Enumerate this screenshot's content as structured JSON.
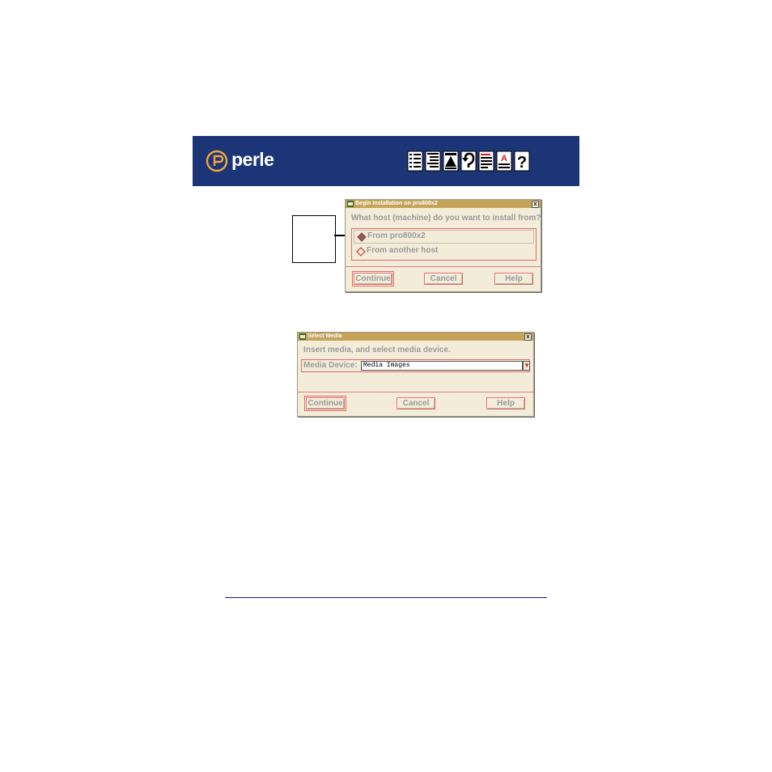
{
  "banner": {
    "brand": "perle",
    "toolbar_icons": [
      "contents-icon",
      "index-icon",
      "top-icon",
      "back-icon",
      "document-icon",
      "text-icon",
      "help-icon"
    ],
    "help_glyph": "?",
    "text_glyph": "A"
  },
  "dialog_install": {
    "title": "Begin Installation on pro800x2",
    "close_glyph": "x",
    "prompt": "What host (machine) do you want to install from?",
    "options": [
      {
        "label": "From pro800x2",
        "selected": true
      },
      {
        "label": "From another host",
        "selected": false
      }
    ],
    "continue_label": "Continue",
    "cancel_label": "Cancel",
    "help_label": "Help"
  },
  "dialog_media": {
    "title": "Select Media",
    "close_glyph": "x",
    "prompt": "Insert media, and select media device.",
    "field_label": "Media Device:",
    "field_value": "Media Images",
    "dropdown_glyph": "▼",
    "continue_label": "Continue",
    "cancel_label": "Cancel",
    "help_label": "Help"
  },
  "colors": {
    "banner_bg": "#1c3577",
    "logo_orange": "#f0a640",
    "dialog_bg": "#f2ecd9",
    "titlebar": "#c5a45a",
    "focus_red": "#e26d6d"
  }
}
